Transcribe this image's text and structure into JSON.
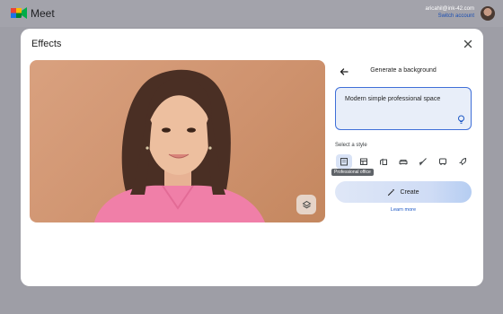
{
  "app": {
    "title": "Meet",
    "logo_icon": "google-meet-logo"
  },
  "account": {
    "email": "aricahil@ink-42.com",
    "switch_label": "Switch account"
  },
  "dialog": {
    "title": "Effects",
    "close_icon": "close-icon",
    "preview": {
      "layers_icon": "layers-icon"
    }
  },
  "generate": {
    "title": "Generate a background",
    "back_icon": "arrow-back-icon",
    "prompt_text": "Modern simple professional space",
    "prompt_icon": "lightbulb-icon",
    "style_label": "Select a style",
    "styles": [
      {
        "name": "Professional office",
        "icon": "office-building-icon",
        "selected": true
      },
      {
        "name": "",
        "icon": "storefront-icon",
        "selected": false
      },
      {
        "name": "",
        "icon": "apartment-icon",
        "selected": false
      },
      {
        "name": "",
        "icon": "sofa-icon",
        "selected": false
      },
      {
        "name": "",
        "icon": "paint-brush-icon",
        "selected": false
      },
      {
        "name": "",
        "icon": "bus-icon",
        "selected": false
      },
      {
        "name": "",
        "icon": "rocket-icon",
        "selected": false
      }
    ],
    "tooltip": "Professional office",
    "create_label": "Create",
    "create_icon": "magic-wand-icon",
    "learn_more": "Learn more"
  },
  "colors": {
    "accent": "#1a56c4",
    "prompt_border": "#3f6fd8",
    "overlay": "#9e9ea6",
    "preview_background": "#d49b78",
    "shirt": "#f07fa8"
  }
}
